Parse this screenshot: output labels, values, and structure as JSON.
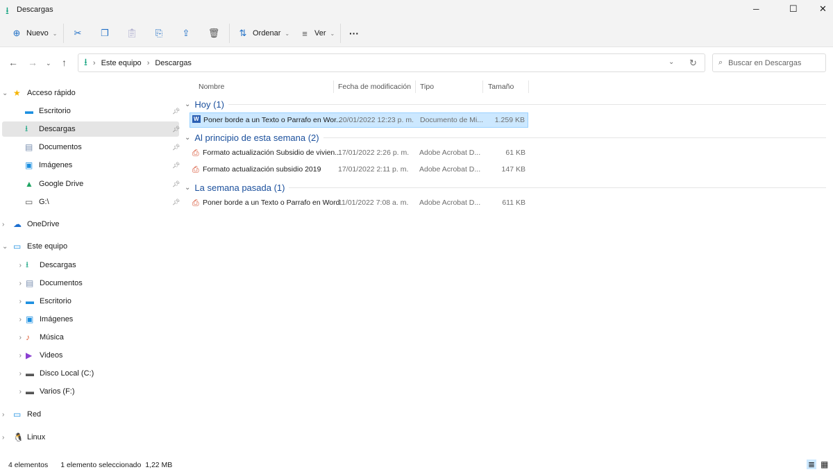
{
  "window": {
    "title": "Descargas",
    "controls": [
      "─",
      "☐",
      "✕"
    ]
  },
  "toolbar": {
    "new_label": "Nuevo",
    "sort_label": "Ordenar",
    "view_label": "Ver",
    "more": "···"
  },
  "address": {
    "crumbs": [
      "Este equipo",
      "Descargas"
    ],
    "search_placeholder": "Buscar en Descargas"
  },
  "sidebar": {
    "items": [
      {
        "label": "Acceso rápido",
        "icon": "★",
        "color": "#f5b400",
        "indent": 0,
        "expander": "⌄"
      },
      {
        "label": "Escritorio",
        "icon": "▬",
        "color": "#1c8fe0",
        "indent": 1,
        "pin": true
      },
      {
        "label": "Descargas",
        "icon": "⭳",
        "color": "#12a37f",
        "indent": 1,
        "pin": true,
        "selected": true
      },
      {
        "label": "Documentos",
        "icon": "▤",
        "color": "#7a8fb0",
        "indent": 1,
        "pin": true
      },
      {
        "label": "Imágenes",
        "icon": "▣",
        "color": "#1c8fe0",
        "indent": 1,
        "pin": true
      },
      {
        "label": "Google Drive",
        "icon": "▲",
        "color": "#1fa463",
        "indent": 1,
        "pin": true
      },
      {
        "label": "G:\\",
        "icon": "▭",
        "color": "#555",
        "indent": 1,
        "pin": true
      },
      {
        "label": "OneDrive",
        "icon": "☁",
        "color": "#1c6fd0",
        "indent": 0,
        "expander": "›"
      },
      {
        "label": "Este equipo",
        "icon": "▭",
        "color": "#1c8fe0",
        "indent": 0,
        "expander": "⌄"
      },
      {
        "label": "Descargas",
        "icon": "⭳",
        "color": "#12a37f",
        "indent": 1,
        "expander": "›"
      },
      {
        "label": "Documentos",
        "icon": "▤",
        "color": "#7a8fb0",
        "indent": 1,
        "expander": "›"
      },
      {
        "label": "Escritorio",
        "icon": "▬",
        "color": "#1c8fe0",
        "indent": 1,
        "expander": "›"
      },
      {
        "label": "Imágenes",
        "icon": "▣",
        "color": "#1c8fe0",
        "indent": 1,
        "expander": "›"
      },
      {
        "label": "Música",
        "icon": "♪",
        "color": "#e0633c",
        "indent": 1,
        "expander": "›"
      },
      {
        "label": "Videos",
        "icon": "▶",
        "color": "#8a3fd1",
        "indent": 1,
        "expander": "›"
      },
      {
        "label": "Disco Local (C:)",
        "icon": "▬",
        "color": "#555",
        "indent": 1,
        "expander": "›"
      },
      {
        "label": "Varios (F:)",
        "icon": "▬",
        "color": "#555",
        "indent": 1,
        "expander": "›"
      },
      {
        "label": "Red",
        "icon": "▭",
        "color": "#1c8fe0",
        "indent": 0,
        "expander": "›"
      },
      {
        "label": "Linux",
        "icon": "🐧",
        "color": "#333",
        "indent": 0,
        "expander": "›"
      }
    ]
  },
  "columns": [
    "Nombre",
    "Fecha de modificación",
    "Tipo",
    "Tamaño"
  ],
  "groups": [
    {
      "label": "Hoy (1)",
      "files": [
        {
          "name": "Poner borde a un Texto o Parrafo en Wor...",
          "date": "20/01/2022 12:23 p. m.",
          "type": "Documento de Mi...",
          "size": "1.259 KB",
          "icon": "word",
          "selected": true
        }
      ]
    },
    {
      "label": "Al principio de esta semana (2)",
      "files": [
        {
          "name": "Formato actualización Subsidio de vivien...",
          "date": "17/01/2022 2:26 p. m.",
          "type": "Adobe Acrobat D...",
          "size": "61 KB",
          "icon": "pdf"
        },
        {
          "name": "Formato actualización subsidio 2019",
          "date": "17/01/2022 2:11 p. m.",
          "type": "Adobe Acrobat D...",
          "size": "147 KB",
          "icon": "pdf"
        }
      ]
    },
    {
      "label": "La semana pasada (1)",
      "files": [
        {
          "name": "Poner borde a un Texto o Parrafo en Word",
          "date": "11/01/2022 7:08 a. m.",
          "type": "Adobe Acrobat D...",
          "size": "611 KB",
          "icon": "pdf"
        }
      ]
    }
  ],
  "status": {
    "count": "4 elementos",
    "selection": "1 elemento seleccionado  1,22 MB"
  }
}
